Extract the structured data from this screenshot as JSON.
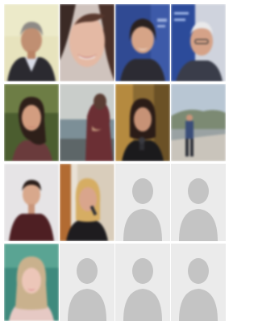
{
  "members": [
    {
      "kind": "photo",
      "icon": "user-photo",
      "label": ""
    },
    {
      "kind": "photo",
      "icon": "user-photo",
      "label": ""
    },
    {
      "kind": "photo",
      "icon": "user-photo",
      "label": ""
    },
    {
      "kind": "photo",
      "icon": "user-photo",
      "label": ""
    },
    {
      "kind": "photo",
      "icon": "user-photo",
      "label": ""
    },
    {
      "kind": "photo",
      "icon": "user-photo",
      "label": ""
    },
    {
      "kind": "photo",
      "icon": "user-photo",
      "label": ""
    },
    {
      "kind": "photo",
      "icon": "user-photo",
      "label": ""
    },
    {
      "kind": "photo",
      "icon": "user-photo",
      "label": ""
    },
    {
      "kind": "photo",
      "icon": "user-photo",
      "label": ""
    },
    {
      "kind": "placeholder",
      "icon": "default-avatar-icon",
      "label": ""
    },
    {
      "kind": "placeholder",
      "icon": "default-avatar-icon",
      "label": ""
    },
    {
      "kind": "photo",
      "icon": "user-photo",
      "label": ""
    },
    {
      "kind": "placeholder",
      "icon": "default-avatar-icon",
      "label": ""
    },
    {
      "kind": "placeholder",
      "icon": "default-avatar-icon",
      "label": ""
    },
    {
      "kind": "placeholder",
      "icon": "default-avatar-icon",
      "label": ""
    }
  ],
  "colors": {
    "placeholder_bg": "#ebebeb",
    "placeholder_figure": "#c4c4c4"
  }
}
